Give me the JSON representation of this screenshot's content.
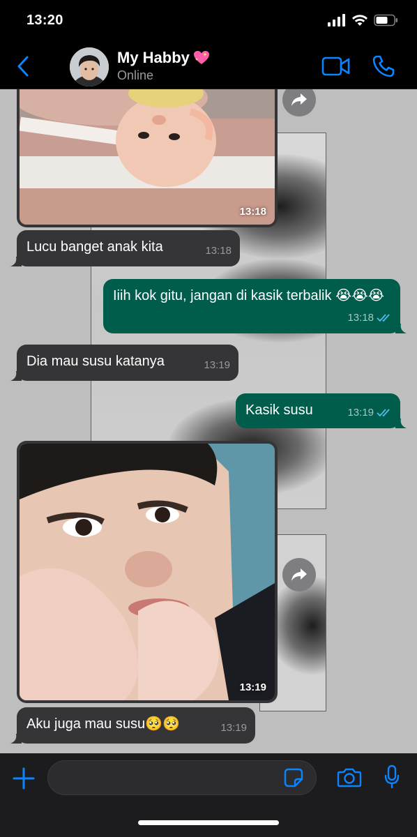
{
  "status_bar": {
    "time": "13:20"
  },
  "header": {
    "contact_name": "My Habby",
    "contact_status": "Online",
    "name_emoji_icon": "sparkling-heart-icon",
    "icons": {
      "back": "chevron-left-icon",
      "video": "video-camera-icon",
      "call": "phone-icon"
    },
    "accent_color": "#0a84ff"
  },
  "messages": [
    {
      "type": "image",
      "direction": "in",
      "subject": "baby photo",
      "time": "13:18"
    },
    {
      "type": "text",
      "direction": "in",
      "text": "Lucu banget anak kita",
      "time": "13:18"
    },
    {
      "type": "text",
      "direction": "out",
      "text": "Iiih kok gitu, jangan di kasik terbalik 😭😭😭",
      "time": "13:18",
      "status": "read"
    },
    {
      "type": "text",
      "direction": "in",
      "text": "Dia mau susu katanya",
      "time": "13:19"
    },
    {
      "type": "text",
      "direction": "out",
      "text": "Kasik susu",
      "time": "13:19",
      "status": "read"
    },
    {
      "type": "image",
      "direction": "in",
      "subject": "selfie photo",
      "time": "13:19"
    },
    {
      "type": "text",
      "direction": "in",
      "text": "Aku juga mau susu🥺🥺",
      "time": "13:19"
    }
  ],
  "input_bar": {
    "placeholder": "",
    "icons": {
      "attach": "plus-icon",
      "sticker": "sticker-icon",
      "camera": "camera-icon",
      "mic": "microphone-icon"
    }
  },
  "colors": {
    "incoming_bubble": "#353537",
    "outgoing_bubble": "#005c4b",
    "read_tick": "#53bdeb",
    "chat_background": "#bebebe"
  }
}
